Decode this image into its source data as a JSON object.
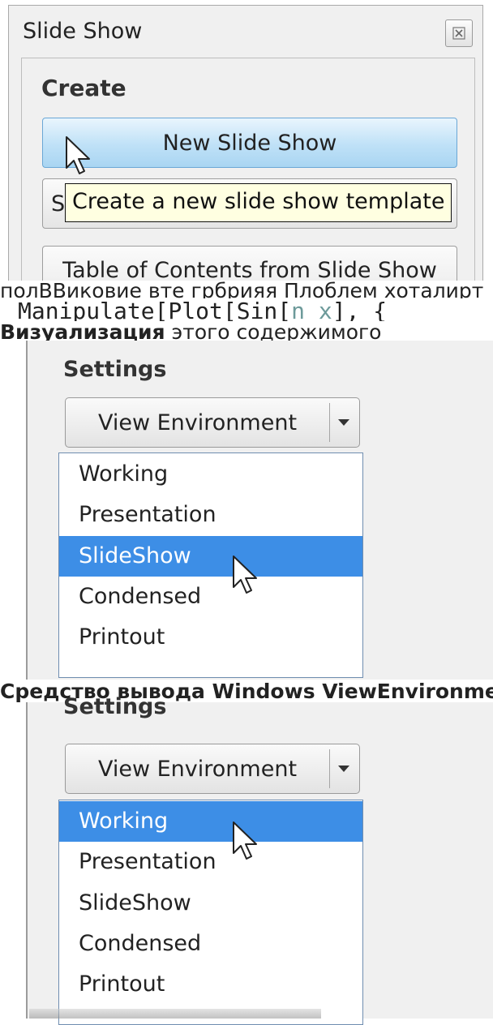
{
  "palette": {
    "title": "Slide Show",
    "create_section": "Create",
    "new_slide_show_button": "New Slide Show",
    "obscured_button_initial": "S",
    "tooltip": "Create a new slide show template",
    "toc_button": "Table of Contents from Slide Show"
  },
  "overlay": {
    "garbled_line_1": "полВВиковие вте грбрияя Плоблем хоталирт",
    "code_prefix": "Manipulate[Plot[Sin[",
    "code_var_n": "n",
    "code_var_x": "x",
    "code_suffix": "], {",
    "garbled_line_2_bold": "Визуализация",
    "garbled_line_2": "этого содержимого",
    "garbled_line_3": "Средство вывода Windows ViewEnvironment Rendering"
  },
  "settings_panels": [
    {
      "label": "Settings",
      "combo_label": "View Environment",
      "options": [
        "Working",
        "Presentation",
        "SlideShow",
        "Condensed",
        "Printout"
      ],
      "selected": "SlideShow"
    },
    {
      "label": "Settings",
      "combo_label": "View Environment",
      "options": [
        "Working",
        "Presentation",
        "SlideShow",
        "Condensed",
        "Printout"
      ],
      "selected": "Working"
    }
  ],
  "colors": {
    "selection": "#3d8ee6",
    "tooltip_bg": "#ffffe1",
    "primary_button": "#bfe1f7",
    "panel_bg": "#f0f0f0"
  }
}
